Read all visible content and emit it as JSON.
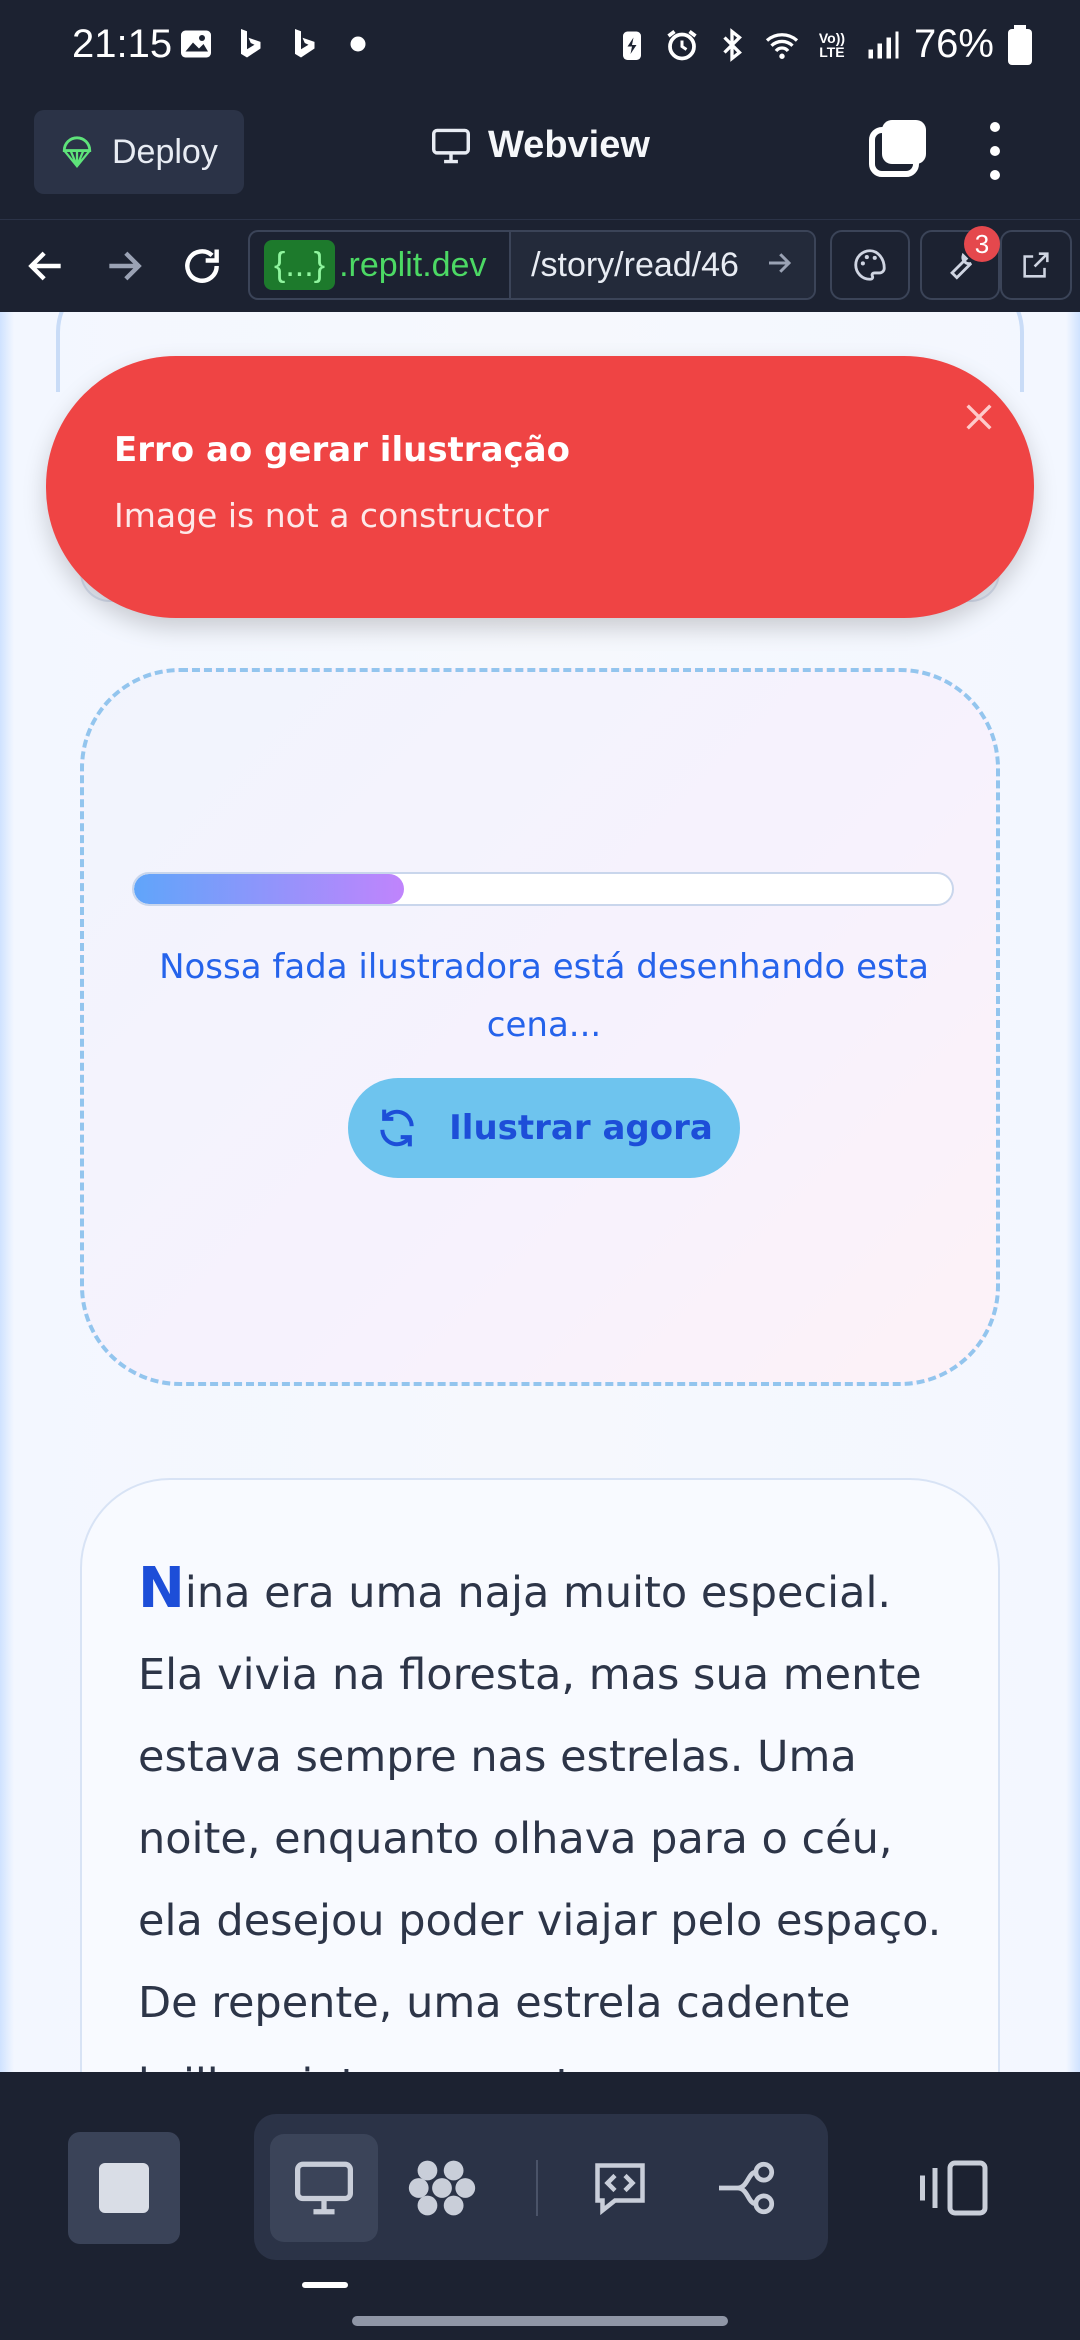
{
  "status_bar": {
    "time": "21:15",
    "battery": "76%",
    "left_icons": [
      "image-icon",
      "bing-icon",
      "bing-icon",
      "dot-icon"
    ],
    "right_icons": [
      "battery-saver-icon",
      "alarm-icon",
      "bluetooth-icon",
      "wifi-icon",
      "volte-icon",
      "signal-icon",
      "battery-icon"
    ],
    "volte_label": "Vo)) LTE"
  },
  "topbar": {
    "deploy_label": "Deploy",
    "title": "Webview"
  },
  "address_bar": {
    "host_tag": "{...}",
    "host": ".replit.dev",
    "path": "/story/read/46",
    "notification_count": "3"
  },
  "toast": {
    "title": "Erro ao gerar ilustração",
    "message": "Image is not a constructor"
  },
  "illustration": {
    "progress": 0.33,
    "loading_text": "Nossa fada ilustradora está desenhando esta cena...",
    "button_label": "Ilustrar agora"
  },
  "story": {
    "drop_cap": "N",
    "text": "ina era uma naja muito especial. Ela vivia na floresta, mas sua mente estava sempre nas estrelas. Uma noite, enquanto olhava para o céu, ela desejou poder viajar pelo espaço. De repente, uma estrela cadente brilhou intensamente."
  },
  "colors": {
    "toast_bg": "#ef4444",
    "accent_blue": "#2563eb",
    "button_bg": "#6ec4ee",
    "progress_start": "#60a5fa",
    "progress_end": "#c084fc",
    "chrome_bg": "#1c2231"
  }
}
